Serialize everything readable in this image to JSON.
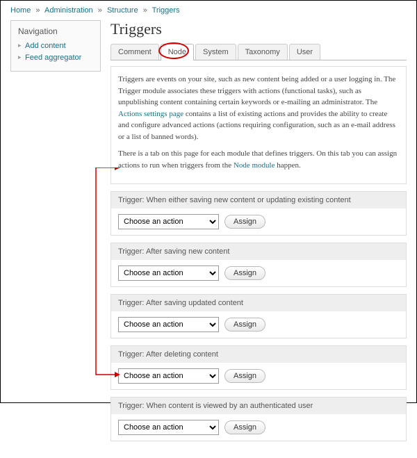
{
  "breadcrumb": [
    {
      "label": "Home"
    },
    {
      "label": "Administration"
    },
    {
      "label": "Structure"
    },
    {
      "label": "Triggers"
    }
  ],
  "sidebar": {
    "title": "Navigation",
    "links": [
      {
        "label": "Add content"
      },
      {
        "label": "Feed aggregator"
      }
    ]
  },
  "page_title": "Triggers",
  "tabs": [
    {
      "label": "Comment",
      "active": false
    },
    {
      "label": "Node",
      "active": true,
      "circled": true
    },
    {
      "label": "System",
      "active": false
    },
    {
      "label": "Taxonomy",
      "active": false
    },
    {
      "label": "User",
      "active": false
    }
  ],
  "help": {
    "p1_pre": "Triggers are events on your site, such as new content being added or a user logging in. The Trigger module associates these triggers with actions (functional tasks), such as unpublishing content containing certain keywords or e-mailing an administrator. The ",
    "p1_link": "Actions settings page",
    "p1_post": " contains a list of existing actions and provides the ability to create and configure advanced actions (actions requiring configuration, such as an e-mail address or a list of banned words).",
    "p2_pre": "There is a tab on this page for each module that defines triggers. On this tab you can assign actions to run when triggers from the ",
    "p2_link": "Node module",
    "p2_post": " happen."
  },
  "triggers": [
    {
      "title": "Trigger: When either saving new content or updating existing content"
    },
    {
      "title": "Trigger: After saving new content"
    },
    {
      "title": "Trigger: After saving updated content"
    },
    {
      "title": "Trigger: After deleting content"
    },
    {
      "title": "Trigger: When content is viewed by an authenticated user"
    }
  ],
  "select_placeholder": "Choose an action",
  "assign_label": "Assign"
}
